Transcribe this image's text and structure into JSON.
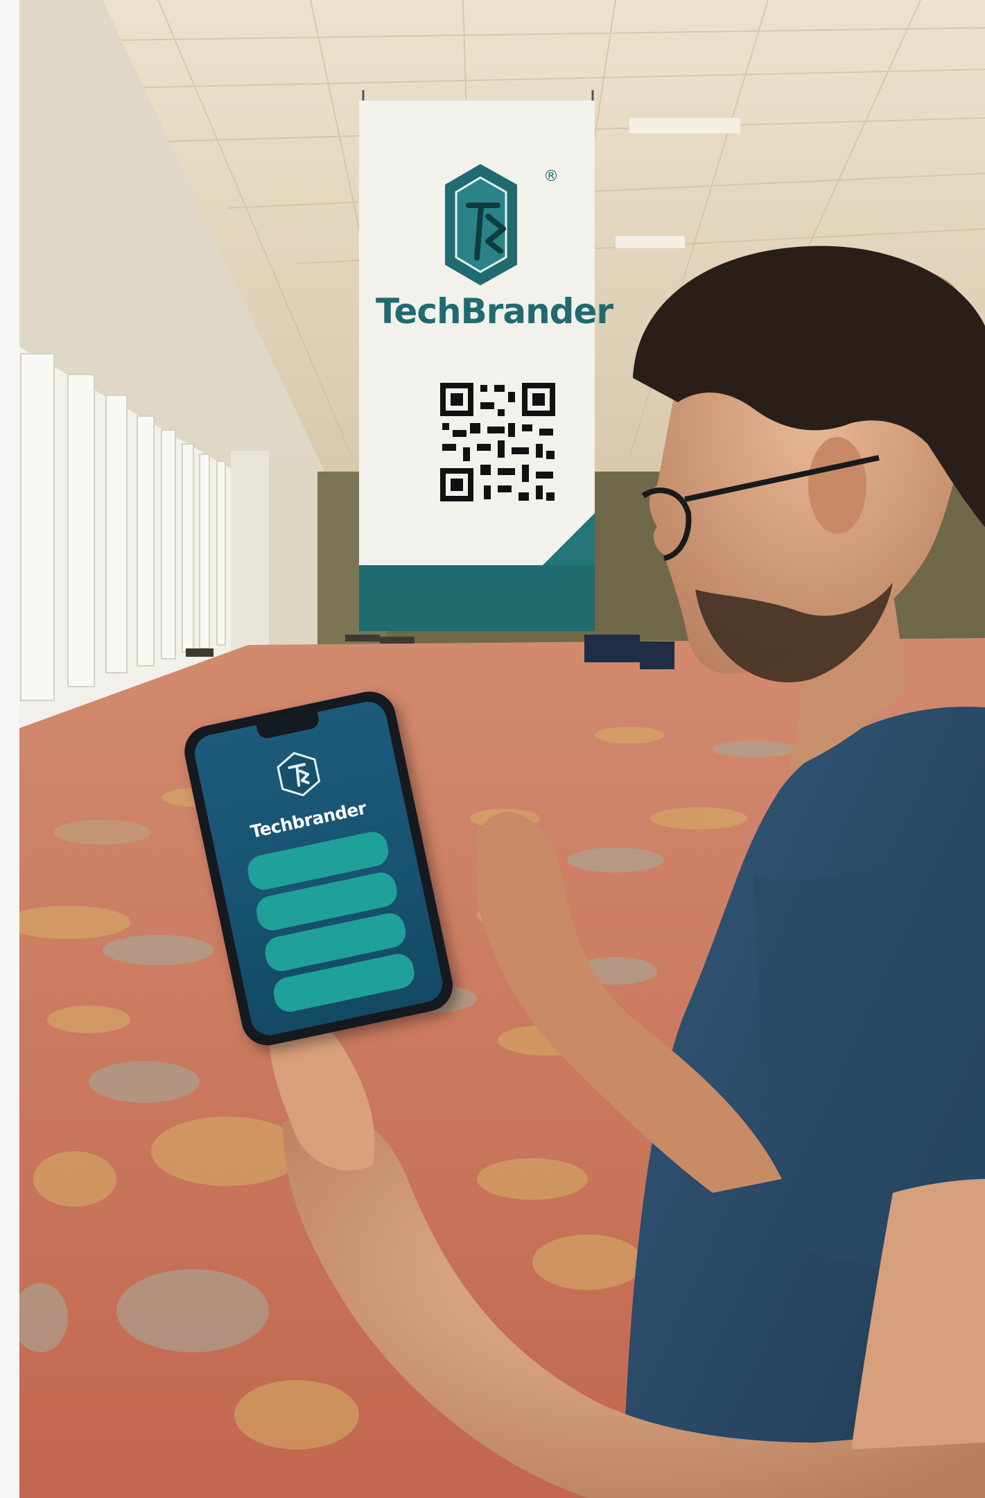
{
  "banner": {
    "brand_name": "TechBrander",
    "registered_mark": "®",
    "logo_icon": "techbrander-hexagon-logo",
    "qr_icon": "qr-code",
    "accent_color": "#1f6b6f"
  },
  "phone_app": {
    "app_name": "Techbrander",
    "logo_icon": "techbrander-hexagon-logo",
    "background_color": "#1d5b7a",
    "card_color": "#1fa09a",
    "cards": [
      {
        "text": ""
      },
      {
        "text": ""
      },
      {
        "text": ""
      },
      {
        "text": ""
      }
    ]
  },
  "scene": {
    "carpet_color": "#c8725c",
    "shirt_color": "#2f5069"
  }
}
